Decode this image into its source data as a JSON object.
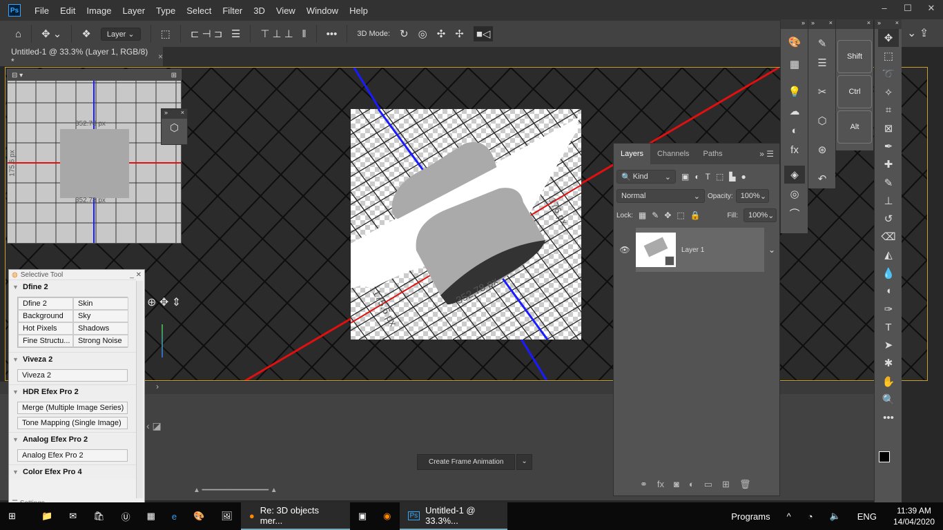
{
  "app": {
    "logo": "Ps",
    "menu": [
      "File",
      "Edit",
      "Image",
      "Layer",
      "Type",
      "Select",
      "Filter",
      "3D",
      "View",
      "Window",
      "Help"
    ]
  },
  "options": {
    "layer_select": "Layer",
    "mode_label": "3D Mode:"
  },
  "document_tab": {
    "title": "Untitled-1 @ 33.3% (Layer 1, RGB/8) *"
  },
  "canvas": {
    "measure_top": "352.78 px",
    "measure_side": "175.6 px",
    "measure_bottom": "352.78 px",
    "measure_doc": "352.78 px",
    "measure_doc2": "175.6 px",
    "measure_doc3": "176 px"
  },
  "colors": {
    "x_axis": "#e01010",
    "y_axis": "#1010e0",
    "accent": "#c8a22a"
  },
  "layers": {
    "tabs": [
      "Layers",
      "Channels",
      "Paths"
    ],
    "filter": "Kind",
    "blend": "Normal",
    "opacity_label": "Opacity:",
    "opacity": "100%",
    "lock_label": "Lock:",
    "fill_label": "Fill:",
    "fill": "100%",
    "items": [
      {
        "name": "Layer 1",
        "visible": true
      }
    ]
  },
  "modifier_keys": [
    "Shift",
    "Ctrl",
    "Alt"
  ],
  "selective_tool": {
    "title": "Selective Tool",
    "sections": [
      {
        "name": "Dfine 2",
        "buttons": [
          "Dfine 2",
          "Skin",
          "Background",
          "Sky",
          "Hot Pixels",
          "Shadows",
          "Fine Structu...",
          "Strong Noise"
        ]
      },
      {
        "name": "Viveza 2",
        "buttons": [
          "Viveza 2"
        ]
      },
      {
        "name": "HDR Efex Pro 2",
        "buttons": [
          "Merge (Multiple Image Series)",
          "Tone Mapping (Single Image)"
        ]
      },
      {
        "name": "Analog Efex Pro 2",
        "buttons": [
          "Analog Efex Pro 2"
        ]
      },
      {
        "name": "Color Efex Pro 4",
        "buttons": []
      }
    ],
    "settings": "Settings"
  },
  "timeline": {
    "create_button": "Create Frame Animation"
  },
  "taskbar": {
    "firefox": "Re: 3D objects mer...",
    "photoshop": "Untitled-1 @ 33.3%...",
    "programs": "Programs",
    "lang": "ENG",
    "time": "11:39 AM",
    "date": "14/04/2020"
  }
}
